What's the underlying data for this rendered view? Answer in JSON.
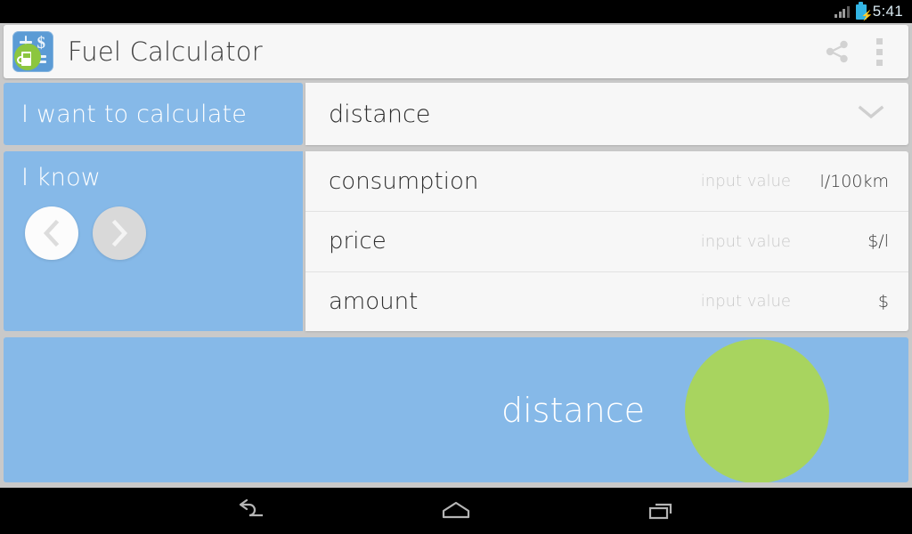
{
  "status_bar": {
    "time": "5:41",
    "signal_icon": "signal-bars-icon",
    "battery_icon": "battery-charging-icon",
    "bolt_glyph": "⚡"
  },
  "app_bar": {
    "title": "Fuel Calculator",
    "icon": "fuel-calculator-app-icon",
    "share_icon": "share-icon",
    "overflow_icon": "overflow-menu-icon",
    "icon_plus": "+",
    "icon_dollar": "$"
  },
  "calculate_row": {
    "label": "I want to calculate",
    "value": "distance",
    "dropdown_icon": "chevron-down-icon"
  },
  "know_section": {
    "label": "I know",
    "prev_icon": "chevron-left-icon",
    "next_icon": "chevron-right-icon",
    "inputs": [
      {
        "name": "consumption",
        "placeholder": "input value",
        "unit": "l/100km",
        "value": ""
      },
      {
        "name": "price",
        "placeholder": "input value",
        "unit": "$/l",
        "value": ""
      },
      {
        "name": "amount",
        "placeholder": "input value",
        "unit": "$",
        "value": ""
      }
    ]
  },
  "result": {
    "label": "distance",
    "value": "",
    "indicator": "result-circle"
  },
  "nav_bar": {
    "back": "back-icon",
    "home": "home-icon",
    "recents": "recent-apps-icon"
  },
  "colors": {
    "accent_blue": "#86b9e8",
    "accent_green": "#a8d45f",
    "panel": "#f7f7f7",
    "background": "#c9c9c9",
    "text_dark": "#2c2c2c",
    "text_placeholder": "#c9c9c9",
    "status_blue": "#33b5e5"
  }
}
